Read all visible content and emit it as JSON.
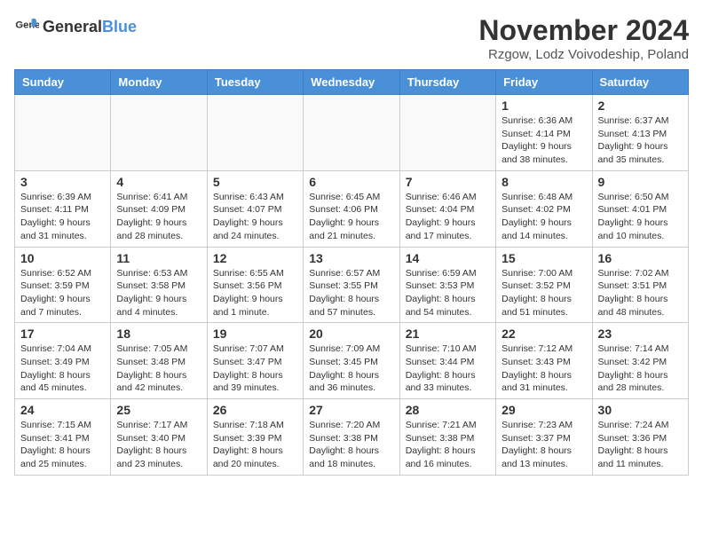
{
  "header": {
    "logo_general": "General",
    "logo_blue": "Blue",
    "month_title": "November 2024",
    "location": "Rzgow, Lodz Voivodeship, Poland"
  },
  "days_of_week": [
    "Sunday",
    "Monday",
    "Tuesday",
    "Wednesday",
    "Thursday",
    "Friday",
    "Saturday"
  ],
  "weeks": [
    [
      {
        "day": "",
        "info": ""
      },
      {
        "day": "",
        "info": ""
      },
      {
        "day": "",
        "info": ""
      },
      {
        "day": "",
        "info": ""
      },
      {
        "day": "",
        "info": ""
      },
      {
        "day": "1",
        "info": "Sunrise: 6:36 AM\nSunset: 4:14 PM\nDaylight: 9 hours and 38 minutes."
      },
      {
        "day": "2",
        "info": "Sunrise: 6:37 AM\nSunset: 4:13 PM\nDaylight: 9 hours and 35 minutes."
      }
    ],
    [
      {
        "day": "3",
        "info": "Sunrise: 6:39 AM\nSunset: 4:11 PM\nDaylight: 9 hours and 31 minutes."
      },
      {
        "day": "4",
        "info": "Sunrise: 6:41 AM\nSunset: 4:09 PM\nDaylight: 9 hours and 28 minutes."
      },
      {
        "day": "5",
        "info": "Sunrise: 6:43 AM\nSunset: 4:07 PM\nDaylight: 9 hours and 24 minutes."
      },
      {
        "day": "6",
        "info": "Sunrise: 6:45 AM\nSunset: 4:06 PM\nDaylight: 9 hours and 21 minutes."
      },
      {
        "day": "7",
        "info": "Sunrise: 6:46 AM\nSunset: 4:04 PM\nDaylight: 9 hours and 17 minutes."
      },
      {
        "day": "8",
        "info": "Sunrise: 6:48 AM\nSunset: 4:02 PM\nDaylight: 9 hours and 14 minutes."
      },
      {
        "day": "9",
        "info": "Sunrise: 6:50 AM\nSunset: 4:01 PM\nDaylight: 9 hours and 10 minutes."
      }
    ],
    [
      {
        "day": "10",
        "info": "Sunrise: 6:52 AM\nSunset: 3:59 PM\nDaylight: 9 hours and 7 minutes."
      },
      {
        "day": "11",
        "info": "Sunrise: 6:53 AM\nSunset: 3:58 PM\nDaylight: 9 hours and 4 minutes."
      },
      {
        "day": "12",
        "info": "Sunrise: 6:55 AM\nSunset: 3:56 PM\nDaylight: 9 hours and 1 minute."
      },
      {
        "day": "13",
        "info": "Sunrise: 6:57 AM\nSunset: 3:55 PM\nDaylight: 8 hours and 57 minutes."
      },
      {
        "day": "14",
        "info": "Sunrise: 6:59 AM\nSunset: 3:53 PM\nDaylight: 8 hours and 54 minutes."
      },
      {
        "day": "15",
        "info": "Sunrise: 7:00 AM\nSunset: 3:52 PM\nDaylight: 8 hours and 51 minutes."
      },
      {
        "day": "16",
        "info": "Sunrise: 7:02 AM\nSunset: 3:51 PM\nDaylight: 8 hours and 48 minutes."
      }
    ],
    [
      {
        "day": "17",
        "info": "Sunrise: 7:04 AM\nSunset: 3:49 PM\nDaylight: 8 hours and 45 minutes."
      },
      {
        "day": "18",
        "info": "Sunrise: 7:05 AM\nSunset: 3:48 PM\nDaylight: 8 hours and 42 minutes."
      },
      {
        "day": "19",
        "info": "Sunrise: 7:07 AM\nSunset: 3:47 PM\nDaylight: 8 hours and 39 minutes."
      },
      {
        "day": "20",
        "info": "Sunrise: 7:09 AM\nSunset: 3:45 PM\nDaylight: 8 hours and 36 minutes."
      },
      {
        "day": "21",
        "info": "Sunrise: 7:10 AM\nSunset: 3:44 PM\nDaylight: 8 hours and 33 minutes."
      },
      {
        "day": "22",
        "info": "Sunrise: 7:12 AM\nSunset: 3:43 PM\nDaylight: 8 hours and 31 minutes."
      },
      {
        "day": "23",
        "info": "Sunrise: 7:14 AM\nSunset: 3:42 PM\nDaylight: 8 hours and 28 minutes."
      }
    ],
    [
      {
        "day": "24",
        "info": "Sunrise: 7:15 AM\nSunset: 3:41 PM\nDaylight: 8 hours and 25 minutes."
      },
      {
        "day": "25",
        "info": "Sunrise: 7:17 AM\nSunset: 3:40 PM\nDaylight: 8 hours and 23 minutes."
      },
      {
        "day": "26",
        "info": "Sunrise: 7:18 AM\nSunset: 3:39 PM\nDaylight: 8 hours and 20 minutes."
      },
      {
        "day": "27",
        "info": "Sunrise: 7:20 AM\nSunset: 3:38 PM\nDaylight: 8 hours and 18 minutes."
      },
      {
        "day": "28",
        "info": "Sunrise: 7:21 AM\nSunset: 3:38 PM\nDaylight: 8 hours and 16 minutes."
      },
      {
        "day": "29",
        "info": "Sunrise: 7:23 AM\nSunset: 3:37 PM\nDaylight: 8 hours and 13 minutes."
      },
      {
        "day": "30",
        "info": "Sunrise: 7:24 AM\nSunset: 3:36 PM\nDaylight: 8 hours and 11 minutes."
      }
    ]
  ]
}
